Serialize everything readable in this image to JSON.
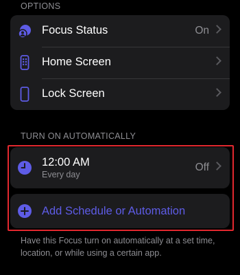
{
  "options": {
    "header": "OPTIONS",
    "items": [
      {
        "label": "Focus Status",
        "value": "On",
        "icon": "focus-status-icon"
      },
      {
        "label": "Home Screen",
        "value": "",
        "icon": "home-screen-icon"
      },
      {
        "label": "Lock Screen",
        "value": "",
        "icon": "lock-screen-icon"
      }
    ]
  },
  "automation": {
    "header": "TURN ON AUTOMATICALLY",
    "schedule": {
      "time": "12:00 AM",
      "repeat": "Every day",
      "status": "Off",
      "icon": "clock-icon"
    },
    "add_label": "Add Schedule or Automation",
    "add_icon": "plus-circle-icon",
    "footer": "Have this Focus turn on automatically at a set time, location, or while using a certain app."
  },
  "colors": {
    "accent": "#5e5ce6",
    "background": "#000000",
    "cell": "#1c1c1e",
    "secondary_text": "#8e8e93",
    "highlight": "#e3282f"
  }
}
